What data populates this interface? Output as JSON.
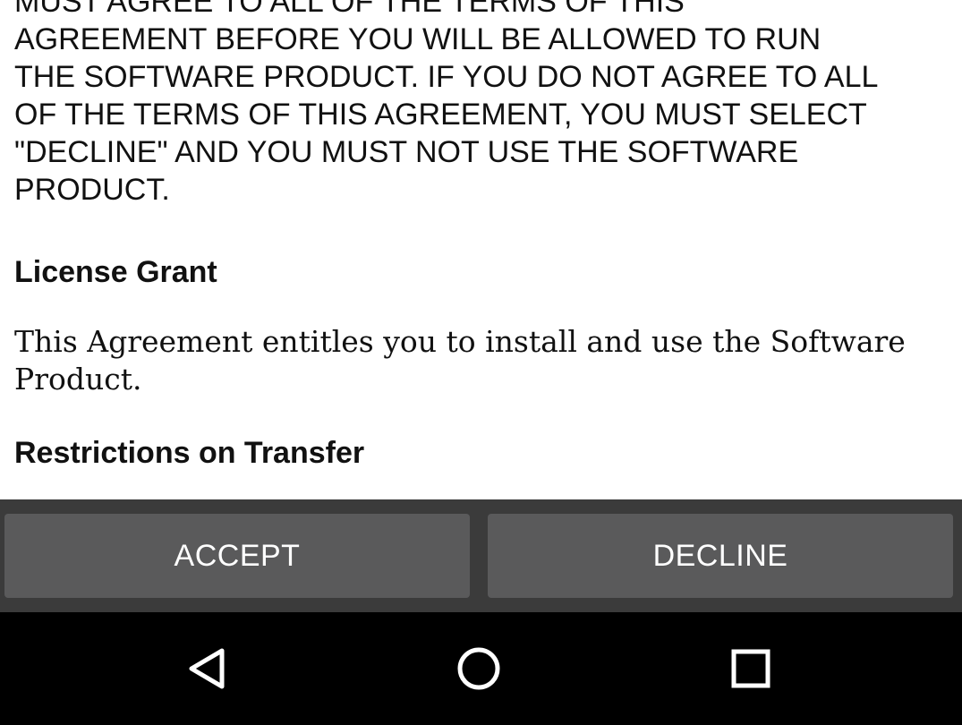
{
  "agreement": {
    "intro_text": "MUST AGREE TO ALL OF THE TERMS OF THIS\nAGREEMENT BEFORE YOU WILL BE ALLOWED TO RUN\nTHE SOFTWARE PRODUCT. IF YOU DO NOT AGREE TO ALL\nOF THE TERMS OF THIS AGREEMENT, YOU MUST SELECT\n\"DECLINE\" AND YOU MUST NOT USE THE SOFTWARE\nPRODUCT.",
    "section_1_heading": "License Grant",
    "section_1_body": "This Agreement entitles you to install and use the Software Product.",
    "section_2_heading": "Restrictions on Transfer"
  },
  "buttons": {
    "accept_label": "ACCEPT",
    "decline_label": "DECLINE"
  },
  "navigation": {
    "back_icon": "back-triangle-icon",
    "home_icon": "home-circle-icon",
    "recents_icon": "recents-square-icon"
  },
  "colors": {
    "button_bar_bg": "#3b3b3b",
    "button_bg": "#5a5a5b",
    "nav_bar_bg": "#000000",
    "text": "#111111"
  }
}
